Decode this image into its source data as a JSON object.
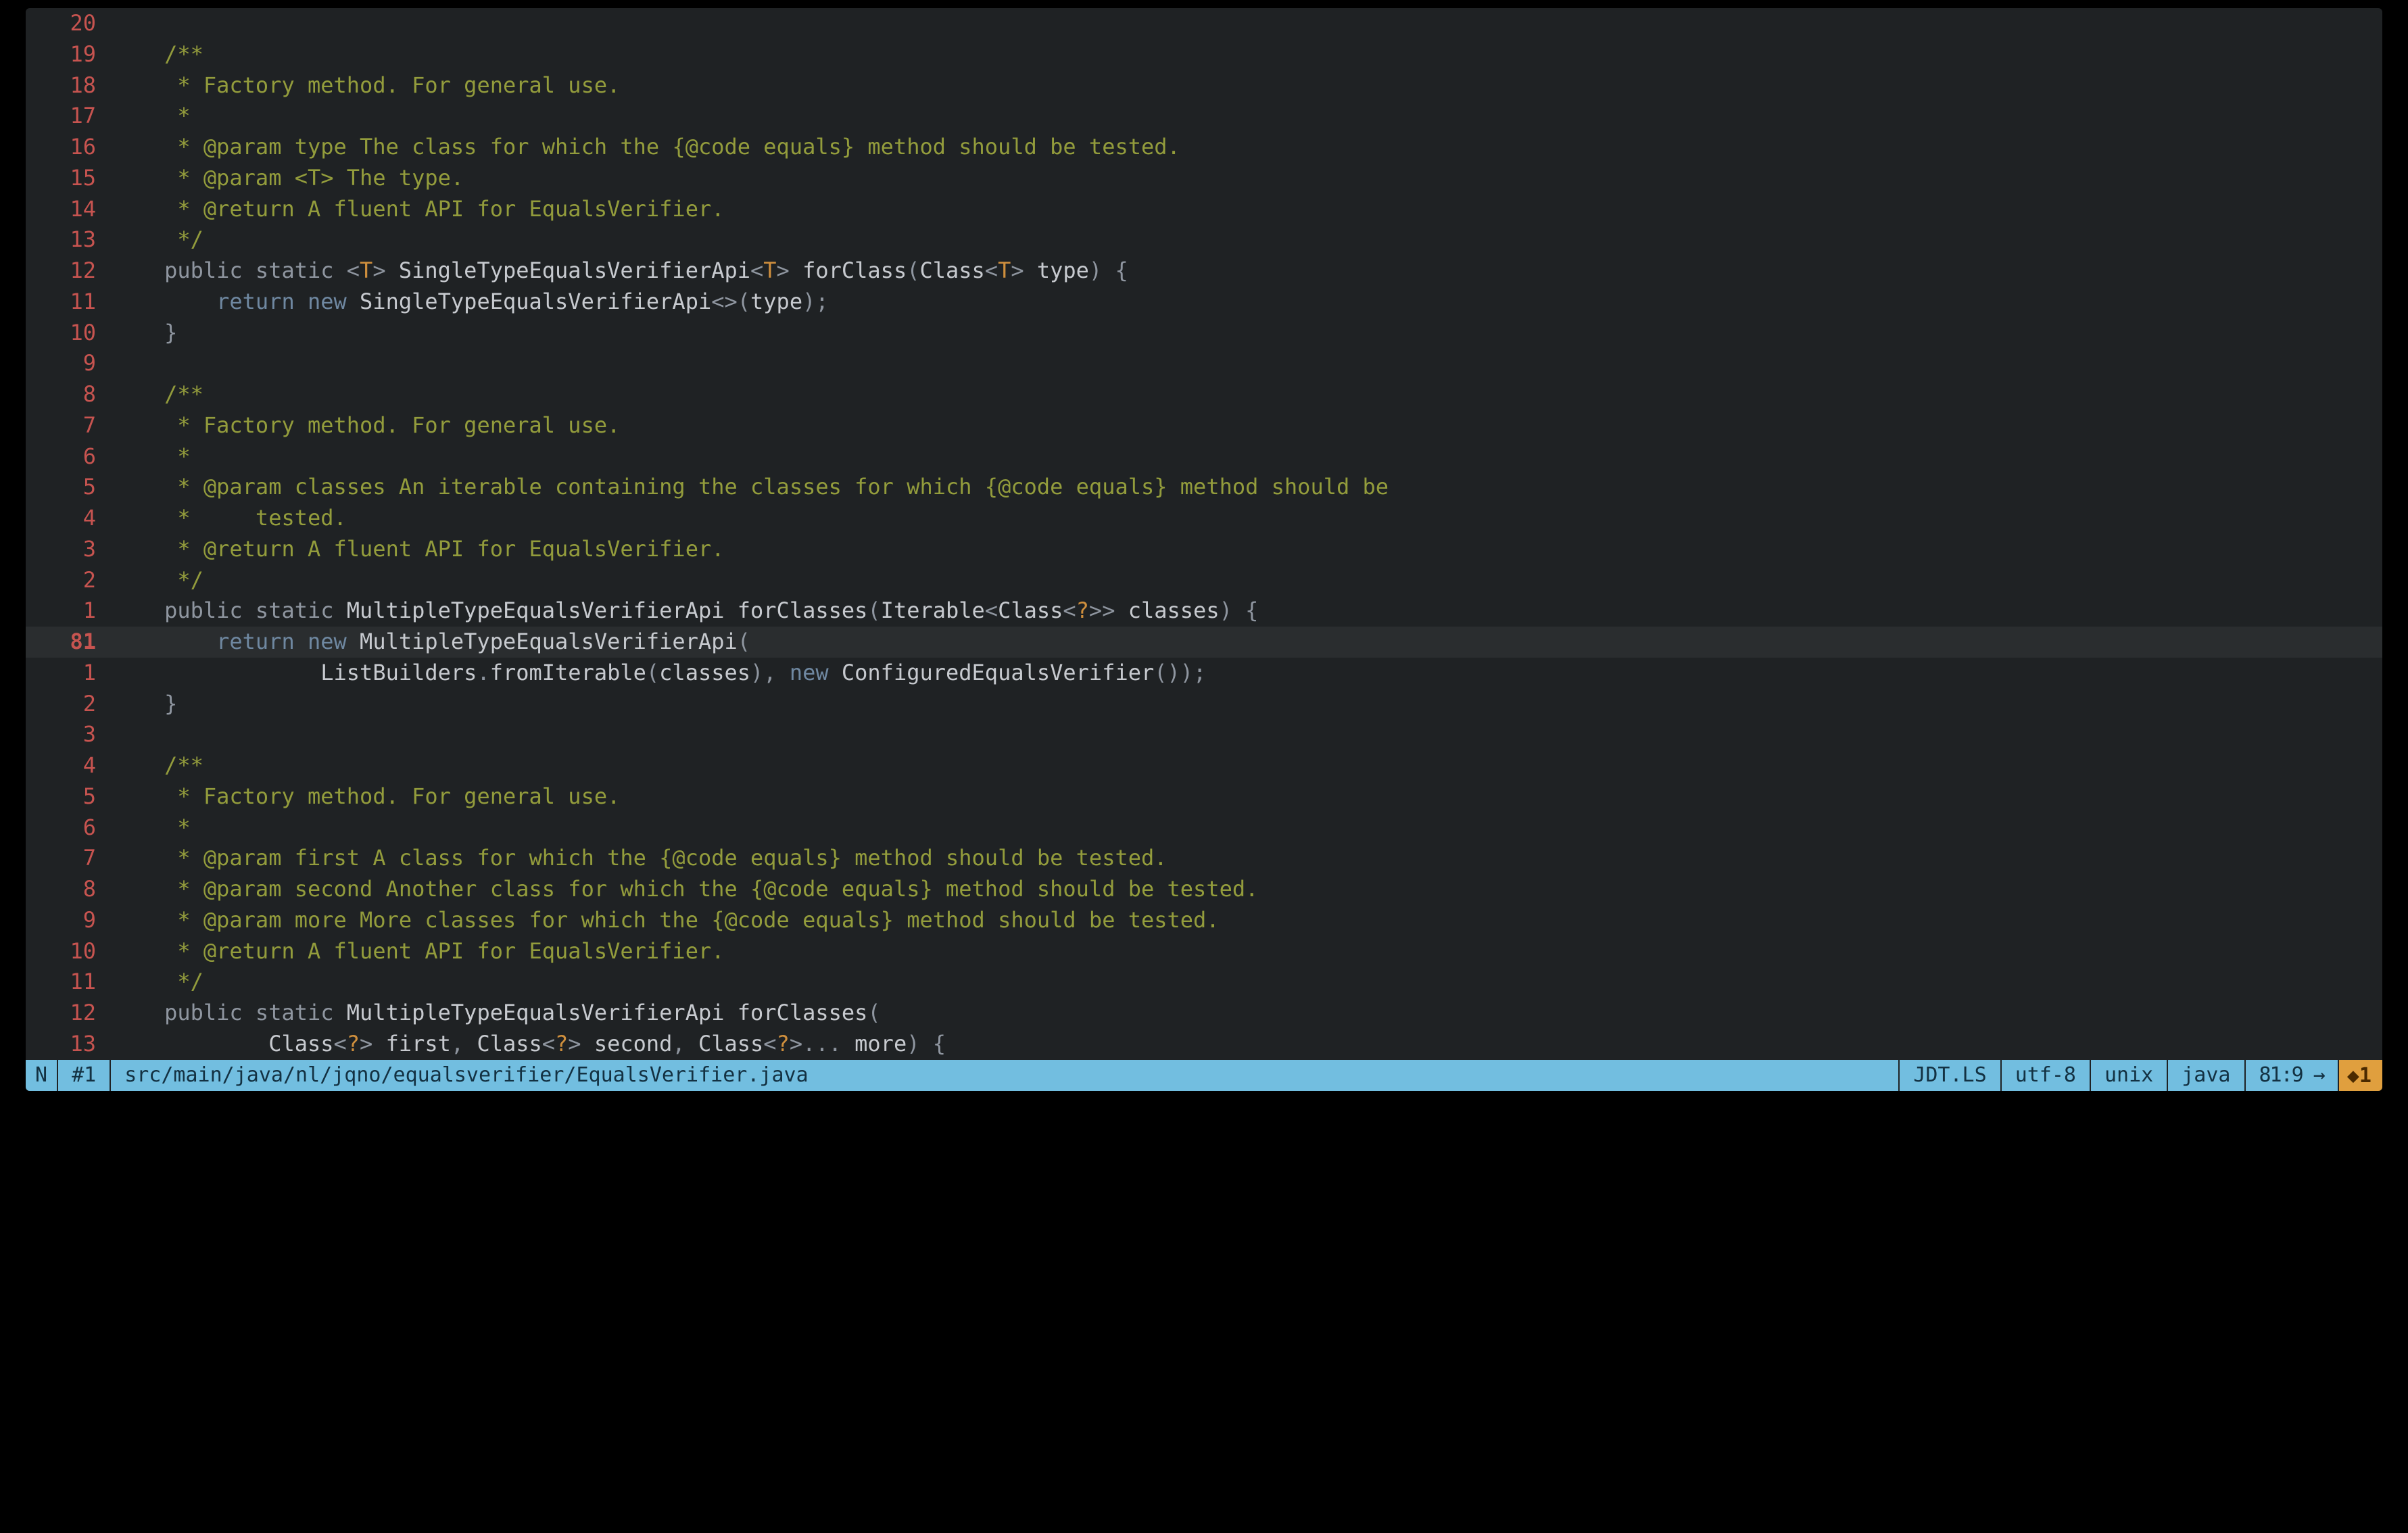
{
  "gutter": {
    "relative": [
      "20",
      "19",
      "18",
      "17",
      "16",
      "15",
      "14",
      "13",
      "12",
      "11",
      "10",
      "9",
      "8",
      "7",
      "6",
      "5",
      "4",
      "3",
      "2",
      "1",
      "81",
      "1",
      "2",
      "3",
      "4",
      "5",
      "6",
      "7",
      "8",
      "9",
      "10",
      "11",
      "12",
      "13"
    ],
    "absolute_index": 20,
    "absolute_value": "81"
  },
  "code_lines": {
    "l0": {
      "blank": ""
    },
    "l1": {
      "indent": "    ",
      "comment": "/**"
    },
    "l2": {
      "indent": "     ",
      "comment": "* Factory method. For general use."
    },
    "l3": {
      "indent": "     ",
      "comment": "*"
    },
    "l4": {
      "indent": "     ",
      "comment": "* @param type The class for which the {@code equals} method should be tested."
    },
    "l5": {
      "indent": "     ",
      "comment": "* @param <T> The type."
    },
    "l6": {
      "indent": "     ",
      "comment": "* @return A fluent API for EqualsVerifier."
    },
    "l7": {
      "indent": "     ",
      "comment": "*/"
    },
    "l8": {
      "indent": "    ",
      "kw1": "public",
      "sp1": " ",
      "kw2": "static",
      "sp2": " ",
      "g1": "<",
      "gt": "T",
      "g2": ">",
      "sp3": " ",
      "type1": "SingleTypeEqualsVerifierApi",
      "g3": "<",
      "gt2": "T",
      "g4": ">",
      "sp4": " ",
      "fn": "forClass",
      "p1": "(",
      "type2": "Class",
      "g5": "<",
      "gt3": "T",
      "g6": ">",
      "sp5": " ",
      "arg": "type",
      "p2": ")",
      "sp6": " ",
      "brace": "{"
    },
    "l9": {
      "indent": "        ",
      "kw": "return",
      "sp1": " ",
      "new": "new",
      "sp2": " ",
      "type": "SingleTypeEqualsVerifierApi",
      "g1": "<>",
      "p1": "(",
      "arg": "type",
      "p2": ")",
      ";": ";"
    },
    "l10": {
      "indent": "    ",
      "brace": "}"
    },
    "l11": {
      "blank": ""
    },
    "l12": {
      "indent": "    ",
      "comment": "/**"
    },
    "l13": {
      "indent": "     ",
      "comment": "* Factory method. For general use."
    },
    "l14": {
      "indent": "     ",
      "comment": "*"
    },
    "l15": {
      "indent": "     ",
      "comment": "* @param classes An iterable containing the classes for which {@code equals} method should be"
    },
    "l16": {
      "indent": "     ",
      "comment": "*     tested."
    },
    "l17": {
      "indent": "     ",
      "comment": "* @return A fluent API for EqualsVerifier."
    },
    "l18": {
      "indent": "     ",
      "comment": "*/"
    },
    "l19": {
      "indent": "    ",
      "kw1": "public",
      "sp1": " ",
      "kw2": "static",
      "sp2": " ",
      "type1": "MultipleTypeEqualsVerifierApi",
      "sp3": " ",
      "fn": "forClasses",
      "p1": "(",
      "type2": "Iterable",
      "g1": "<",
      "type3": "Class",
      "g2": "<",
      "q": "?",
      "g3": ">>",
      "sp4": " ",
      "arg": "classes",
      "p2": ")",
      "sp5": " ",
      "brace": "{"
    },
    "l20": {
      "indent": "        ",
      "kw": "return",
      "sp1": " ",
      "new": "new",
      "sp2": " ",
      "type": "MultipleTypeEqualsVerifierApi",
      "p1": "("
    },
    "l21": {
      "indent": "                ",
      "type1": "ListBuilders",
      "dot": ".",
      "fn": "fromIterable",
      "p1": "(",
      "arg1": "classes",
      "p2": ")",
      "comma": ",",
      "sp": " ",
      "new": "new",
      "sp2": " ",
      "type2": "ConfiguredEqualsVerifier",
      "p3": "()",
      ";": ");"
    },
    "l22": {
      "indent": "    ",
      "brace": "}"
    },
    "l23": {
      "blank": ""
    },
    "l24": {
      "indent": "    ",
      "comment": "/**"
    },
    "l25": {
      "indent": "     ",
      "comment": "* Factory method. For general use."
    },
    "l26": {
      "indent": "     ",
      "comment": "*"
    },
    "l27": {
      "indent": "     ",
      "comment": "* @param first A class for which the {@code equals} method should be tested."
    },
    "l28": {
      "indent": "     ",
      "comment": "* @param second Another class for which the {@code equals} method should be tested."
    },
    "l29": {
      "indent": "     ",
      "comment": "* @param more More classes for which the {@code equals} method should be tested."
    },
    "l30": {
      "indent": "     ",
      "comment": "* @return A fluent API for EqualsVerifier."
    },
    "l31": {
      "indent": "     ",
      "comment": "*/"
    },
    "l32": {
      "indent": "    ",
      "kw1": "public",
      "sp1": " ",
      "kw2": "static",
      "sp2": " ",
      "type1": "MultipleTypeEqualsVerifierApi",
      "sp3": " ",
      "fn": "forClasses",
      "p1": "("
    },
    "l33": {
      "indent": "            ",
      "type1": "Class",
      "g1": "<",
      "q1": "?",
      "g2": ">",
      "sp1": " ",
      "arg1": "first",
      "c1": ",",
      "sp2": " ",
      "type2": "Class",
      "g3": "<",
      "q2": "?",
      "g4": ">",
      "sp3": " ",
      "arg2": "second",
      "c2": ",",
      "sp4": " ",
      "type3": "Class",
      "g5": "<",
      "q3": "?",
      "g6": ">",
      "ell": "...",
      "sp5": " ",
      "arg3": "more",
      "p2": ")",
      "sp6": " ",
      "brace": "{"
    }
  },
  "statusbar": {
    "mode": "N",
    "buffer": "#1",
    "path": "src/main/java/nl/jqno/equalsverifier/EqualsVerifier.java",
    "lsp": "JDT.LS",
    "encoding": "utf-8",
    "fileformat": "unix",
    "filetype": "java",
    "position": "81:9 →",
    "warn": "◆1"
  }
}
